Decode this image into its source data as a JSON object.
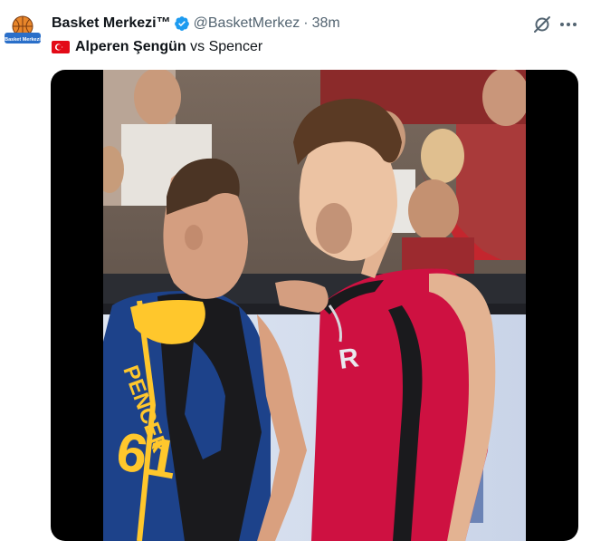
{
  "tweet": {
    "author": {
      "display_name": "Basket Merkezi™",
      "handle": "@BasketMerkez",
      "time": "38m",
      "dot": "·",
      "verified": true,
      "avatar_text": "Basket Merkezi"
    },
    "text": {
      "flag": "turkey-flag",
      "name": "Alperen Şengün",
      "rest": " vs Spencer"
    },
    "media": {
      "type": "video",
      "jersey_text": "PENCER",
      "jersey_number": "61"
    }
  },
  "colors": {
    "verified_blue": "#1d9bf0",
    "muted": "#536471",
    "rockets_red": "#ce1141",
    "warriors_blue": "#1d428a",
    "warriors_gold": "#ffc72c"
  }
}
